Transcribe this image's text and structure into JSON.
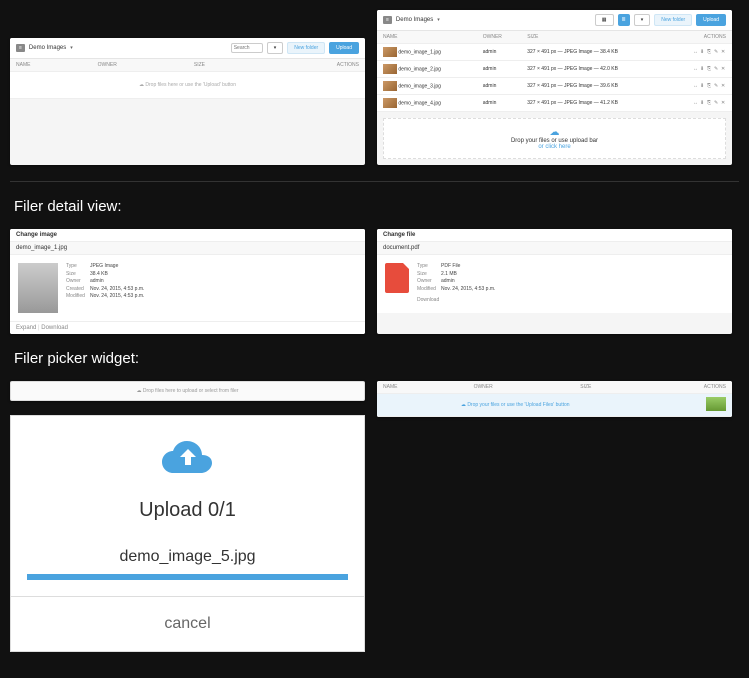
{
  "section1": {
    "heading": "Filer detail view:"
  },
  "section2": {
    "heading": "Filer picker widget:"
  },
  "panel_empty": {
    "title": "Demo Images",
    "search_ph": "Search",
    "btn_new": "New folder",
    "btn_upload": "Upload",
    "cols": {
      "name": "NAME",
      "owner": "OWNER",
      "size": "SIZE",
      "actions": "ACTIONS"
    },
    "drop_text": "Drop files here or use the 'Upload' button"
  },
  "panel_list": {
    "title": "Demo Images",
    "cols": {
      "name": "NAME",
      "owner": "OWNER",
      "size": "SIZE",
      "actions": "ACTIONS"
    },
    "rows": [
      {
        "name": "demo_image_1.jpg",
        "owner": "admin",
        "size": "327 × 491 px — JPEG Image — 38.4 KB"
      },
      {
        "name": "demo_image_2.jpg",
        "owner": "admin",
        "size": "327 × 491 px — JPEG Image — 42.0 KB"
      },
      {
        "name": "demo_image_3.jpg",
        "owner": "admin",
        "size": "327 × 491 px — JPEG Image — 39.6 KB"
      },
      {
        "name": "demo_image_4.jpg",
        "owner": "admin",
        "size": "327 × 491 px — JPEG Image — 41.2 KB"
      }
    ],
    "drop_text": "Drop your files or use upload bar",
    "drop_link": "or click here"
  },
  "detail_img": {
    "header": "Change image",
    "fname": "demo_image_1.jpg",
    "kv": [
      {
        "k": "Type",
        "v": "JPEG Image"
      },
      {
        "k": "Size",
        "v": "38.4 KB"
      },
      {
        "k": "Owner",
        "v": "admin"
      },
      {
        "k": "Created",
        "v": "Nov. 24, 2015, 4:53 p.m."
      },
      {
        "k": "Modified",
        "v": "Nov. 24, 2015, 4:53 p.m."
      }
    ],
    "btn_expand": "Expand",
    "btn_download": "Download"
  },
  "detail_file": {
    "header": "Change file",
    "fname": "document.pdf",
    "kv": [
      {
        "k": "Type",
        "v": "PDF File"
      },
      {
        "k": "Size",
        "v": "2.1 MB"
      },
      {
        "k": "Owner",
        "v": "admin"
      },
      {
        "k": "Modified",
        "v": "Nov. 24, 2015, 4:53 p.m."
      }
    ],
    "btn_download": "Download"
  },
  "picker_empty": {
    "text": "Drop files here to upload or select from filer"
  },
  "picker_model": {
    "cols": {
      "name": "NAME",
      "owner": "OWNER",
      "size": "SIZE",
      "actions": "ACTIONS"
    },
    "text": "Drop your files or use the 'Upload Files' button"
  },
  "upload": {
    "title": "Upload 0/1",
    "filename": "demo_image_5.jpg",
    "cancel": "cancel"
  }
}
